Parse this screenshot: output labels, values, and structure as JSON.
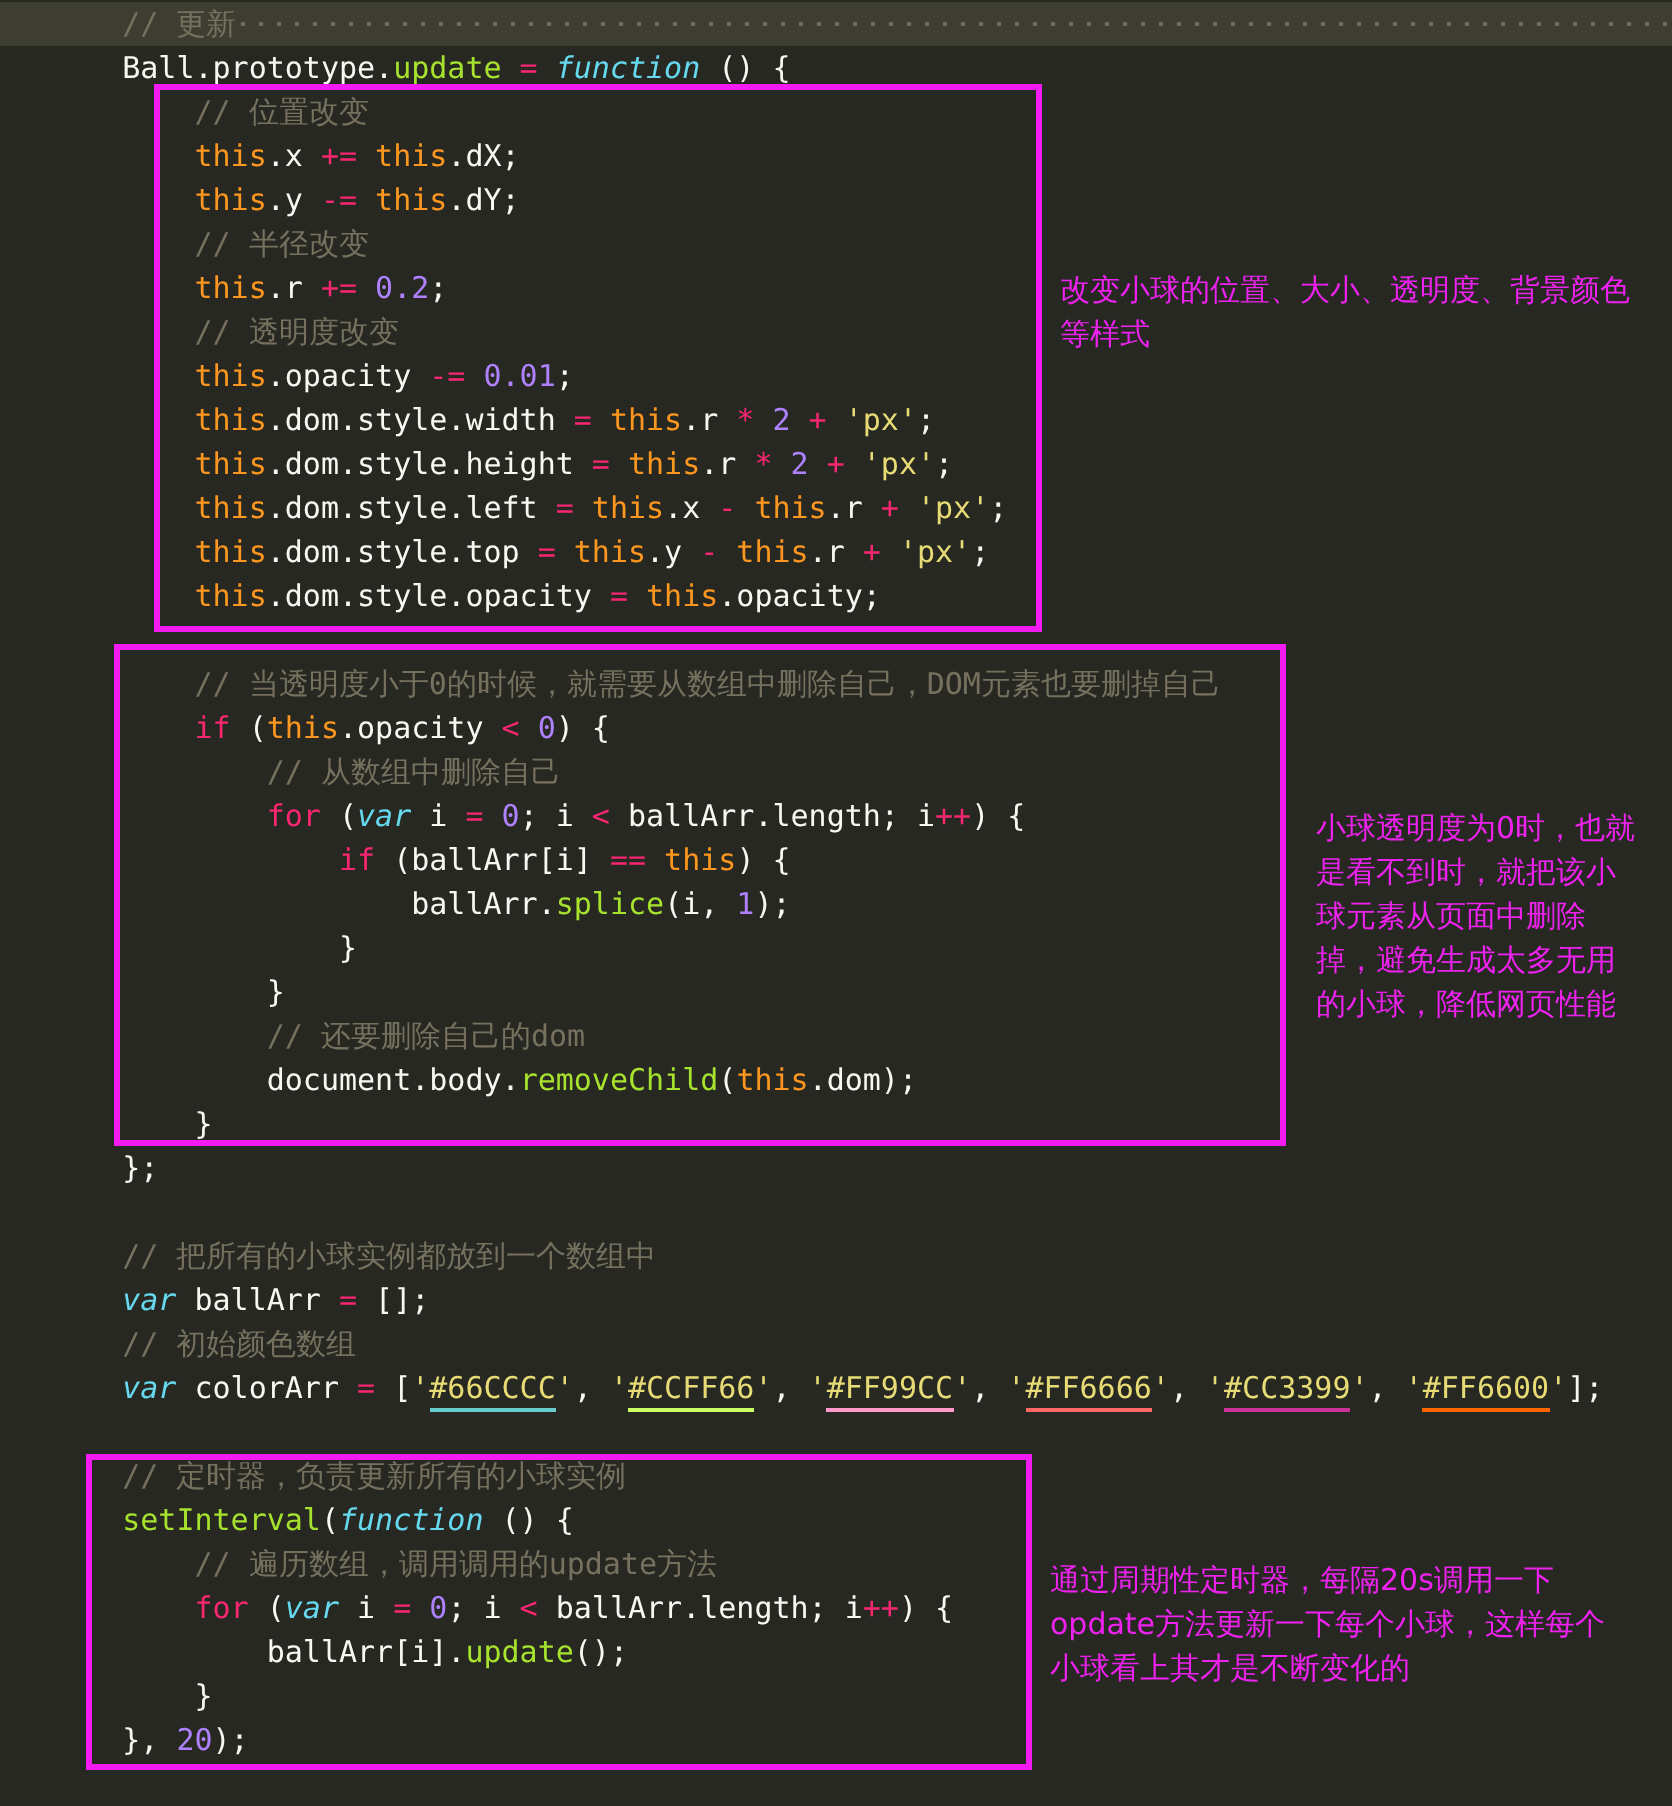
{
  "lines": [
    {
      "kind": "code",
      "current": true,
      "tokens": [
        {
          "kind": "comment",
          "text": "    // 更新"
        }
      ]
    },
    {
      "kind": "code",
      "current": false,
      "tokens": [
        {
          "kind": "plain",
          "text": "    Ball.prototype."
        },
        {
          "kind": "func",
          "text": "update"
        },
        {
          "kind": "op",
          "text": " ="
        },
        {
          "kind": "storage",
          "text": " function"
        },
        {
          "kind": "plain",
          "text": " () {"
        }
      ]
    },
    {
      "kind": "code",
      "current": false,
      "tokens": [
        {
          "kind": "comment",
          "text": "        // 位置改变"
        }
      ]
    },
    {
      "kind": "code",
      "current": false,
      "tokens": [
        {
          "kind": "self",
          "text": "        this"
        },
        {
          "kind": "plain",
          "text": ".x"
        },
        {
          "kind": "op",
          "text": " +="
        },
        {
          "kind": "self",
          "text": " this"
        },
        {
          "kind": "plain",
          "text": ".dX;"
        }
      ]
    },
    {
      "kind": "code",
      "current": false,
      "tokens": [
        {
          "kind": "self",
          "text": "        this"
        },
        {
          "kind": "plain",
          "text": ".y"
        },
        {
          "kind": "op",
          "text": " -="
        },
        {
          "kind": "self",
          "text": " this"
        },
        {
          "kind": "plain",
          "text": ".dY;"
        }
      ]
    },
    {
      "kind": "code",
      "current": false,
      "tokens": [
        {
          "kind": "comment",
          "text": "        // 半径改变"
        }
      ]
    },
    {
      "kind": "code",
      "current": false,
      "tokens": [
        {
          "kind": "self",
          "text": "        this"
        },
        {
          "kind": "plain",
          "text": ".r"
        },
        {
          "kind": "op",
          "text": " +="
        },
        {
          "kind": "number",
          "text": " 0.2"
        },
        {
          "kind": "plain",
          "text": ";"
        }
      ]
    },
    {
      "kind": "code",
      "current": false,
      "tokens": [
        {
          "kind": "comment",
          "text": "        // 透明度改变"
        }
      ]
    },
    {
      "kind": "code",
      "current": false,
      "tokens": [
        {
          "kind": "self",
          "text": "        this"
        },
        {
          "kind": "plain",
          "text": ".opacity"
        },
        {
          "kind": "op",
          "text": " -="
        },
        {
          "kind": "number",
          "text": " 0.01"
        },
        {
          "kind": "plain",
          "text": ";"
        }
      ]
    },
    {
      "kind": "code",
      "current": false,
      "tokens": [
        {
          "kind": "self",
          "text": "        this"
        },
        {
          "kind": "plain",
          "text": ".dom.style.width"
        },
        {
          "kind": "op",
          "text": " ="
        },
        {
          "kind": "self",
          "text": " this"
        },
        {
          "kind": "plain",
          "text": ".r"
        },
        {
          "kind": "op",
          "text": " *"
        },
        {
          "kind": "number",
          "text": " 2"
        },
        {
          "kind": "op",
          "text": " +"
        },
        {
          "kind": "string",
          "text": " 'px'"
        },
        {
          "kind": "plain",
          "text": ";"
        }
      ]
    },
    {
      "kind": "code",
      "current": false,
      "tokens": [
        {
          "kind": "self",
          "text": "        this"
        },
        {
          "kind": "plain",
          "text": ".dom.style.height"
        },
        {
          "kind": "op",
          "text": " ="
        },
        {
          "kind": "self",
          "text": " this"
        },
        {
          "kind": "plain",
          "text": ".r"
        },
        {
          "kind": "op",
          "text": " *"
        },
        {
          "kind": "number",
          "text": " 2"
        },
        {
          "kind": "op",
          "text": " +"
        },
        {
          "kind": "string",
          "text": " 'px'"
        },
        {
          "kind": "plain",
          "text": ";"
        }
      ]
    },
    {
      "kind": "code",
      "current": false,
      "tokens": [
        {
          "kind": "self",
          "text": "        this"
        },
        {
          "kind": "plain",
          "text": ".dom.style.left"
        },
        {
          "kind": "op",
          "text": " ="
        },
        {
          "kind": "self",
          "text": " this"
        },
        {
          "kind": "plain",
          "text": ".x"
        },
        {
          "kind": "op",
          "text": " -"
        },
        {
          "kind": "self",
          "text": " this"
        },
        {
          "kind": "plain",
          "text": ".r"
        },
        {
          "kind": "op",
          "text": " +"
        },
        {
          "kind": "string",
          "text": " 'px'"
        },
        {
          "kind": "plain",
          "text": ";"
        }
      ]
    },
    {
      "kind": "code",
      "current": false,
      "tokens": [
        {
          "kind": "self",
          "text": "        this"
        },
        {
          "kind": "plain",
          "text": ".dom.style.top"
        },
        {
          "kind": "op",
          "text": " ="
        },
        {
          "kind": "self",
          "text": " this"
        },
        {
          "kind": "plain",
          "text": ".y"
        },
        {
          "kind": "op",
          "text": " -"
        },
        {
          "kind": "self",
          "text": " this"
        },
        {
          "kind": "plain",
          "text": ".r"
        },
        {
          "kind": "op",
          "text": " +"
        },
        {
          "kind": "string",
          "text": " 'px'"
        },
        {
          "kind": "plain",
          "text": ";"
        }
      ]
    },
    {
      "kind": "code",
      "current": false,
      "tokens": [
        {
          "kind": "self",
          "text": "        this"
        },
        {
          "kind": "plain",
          "text": ".dom.style.opacity"
        },
        {
          "kind": "op",
          "text": " ="
        },
        {
          "kind": "self",
          "text": " this"
        },
        {
          "kind": "plain",
          "text": ".opacity;"
        }
      ]
    },
    {
      "kind": "blank",
      "current": false
    },
    {
      "kind": "code",
      "current": false,
      "tokens": [
        {
          "kind": "comment",
          "text": "        // 当透明度小于0的时候，就需要从数组中删除自己，DOM元素也要删掉自己"
        }
      ]
    },
    {
      "kind": "code",
      "current": false,
      "tokens": [
        {
          "kind": "op",
          "text": "        if"
        },
        {
          "kind": "plain",
          "text": " ("
        },
        {
          "kind": "self",
          "text": "this"
        },
        {
          "kind": "plain",
          "text": ".opacity"
        },
        {
          "kind": "op",
          "text": " <"
        },
        {
          "kind": "number",
          "text": " 0"
        },
        {
          "kind": "plain",
          "text": ") {"
        }
      ]
    },
    {
      "kind": "code",
      "current": false,
      "tokens": [
        {
          "kind": "comment",
          "text": "            // 从数组中删除自己"
        }
      ]
    },
    {
      "kind": "code",
      "current": false,
      "tokens": [
        {
          "kind": "op",
          "text": "            for"
        },
        {
          "kind": "plain",
          "text": " ("
        },
        {
          "kind": "storage",
          "text": "var"
        },
        {
          "kind": "plain",
          "text": " i"
        },
        {
          "kind": "op",
          "text": " ="
        },
        {
          "kind": "number",
          "text": " 0"
        },
        {
          "kind": "plain",
          "text": "; i"
        },
        {
          "kind": "op",
          "text": " <"
        },
        {
          "kind": "plain",
          "text": " ballArr.length; i"
        },
        {
          "kind": "op",
          "text": "++"
        },
        {
          "kind": "plain",
          "text": ") {"
        }
      ]
    },
    {
      "kind": "code",
      "current": false,
      "tokens": [
        {
          "kind": "op",
          "text": "                if"
        },
        {
          "kind": "plain",
          "text": " (ballArr[i]"
        },
        {
          "kind": "op",
          "text": " =="
        },
        {
          "kind": "self",
          "text": " this"
        },
        {
          "kind": "plain",
          "text": ") {"
        }
      ]
    },
    {
      "kind": "code",
      "current": false,
      "tokens": [
        {
          "kind": "plain",
          "text": "                    ballArr."
        },
        {
          "kind": "func",
          "text": "splice"
        },
        {
          "kind": "plain",
          "text": "(i,"
        },
        {
          "kind": "number",
          "text": " 1"
        },
        {
          "kind": "plain",
          "text": ");"
        }
      ]
    },
    {
      "kind": "code",
      "current": false,
      "tokens": [
        {
          "kind": "plain",
          "text": "                }"
        }
      ]
    },
    {
      "kind": "code",
      "current": false,
      "tokens": [
        {
          "kind": "plain",
          "text": "            }"
        }
      ]
    },
    {
      "kind": "code",
      "current": false,
      "tokens": [
        {
          "kind": "comment",
          "text": "            // 还要删除自己的dom"
        }
      ]
    },
    {
      "kind": "code",
      "current": false,
      "tokens": [
        {
          "kind": "plain",
          "text": "            document.body."
        },
        {
          "kind": "func",
          "text": "removeChild"
        },
        {
          "kind": "plain",
          "text": "("
        },
        {
          "kind": "self",
          "text": "this"
        },
        {
          "kind": "plain",
          "text": ".dom);"
        }
      ]
    },
    {
      "kind": "code",
      "current": false,
      "tokens": [
        {
          "kind": "plain",
          "text": "        }"
        }
      ]
    },
    {
      "kind": "code",
      "current": false,
      "tokens": [
        {
          "kind": "plain",
          "text": "    };"
        }
      ]
    },
    {
      "kind": "blank",
      "current": false
    },
    {
      "kind": "code",
      "current": false,
      "tokens": [
        {
          "kind": "comment",
          "text": "    // 把所有的小球实例都放到一个数组中"
        }
      ]
    },
    {
      "kind": "code",
      "current": false,
      "tokens": [
        {
          "kind": "storage",
          "text": "    var"
        },
        {
          "kind": "plain",
          "text": " ballArr"
        },
        {
          "kind": "op",
          "text": " ="
        },
        {
          "kind": "plain",
          "text": " [];"
        }
      ]
    },
    {
      "kind": "code",
      "current": false,
      "tokens": [
        {
          "kind": "comment",
          "text": "    // 初始颜色数组"
        }
      ]
    },
    {
      "kind": "code",
      "current": false,
      "tokens": [
        {
          "kind": "storage",
          "text": "    var"
        },
        {
          "kind": "plain",
          "text": " colorArr"
        },
        {
          "kind": "op",
          "text": " ="
        },
        {
          "kind": "plain",
          "text": " ["
        },
        {
          "kind": "string",
          "text": "'"
        },
        {
          "kind": "swatch",
          "text": "#66CCCC",
          "color": "#66cccc"
        },
        {
          "kind": "string",
          "text": "'"
        },
        {
          "kind": "plain",
          "text": ","
        },
        {
          "kind": "string",
          "text": " '"
        },
        {
          "kind": "swatch",
          "text": "#CCFF66",
          "color": "#ccff66"
        },
        {
          "kind": "string",
          "text": "'"
        },
        {
          "kind": "plain",
          "text": ","
        },
        {
          "kind": "string",
          "text": " '"
        },
        {
          "kind": "swatch",
          "text": "#FF99CC",
          "color": "#ff99cc"
        },
        {
          "kind": "string",
          "text": "'"
        },
        {
          "kind": "plain",
          "text": ","
        },
        {
          "kind": "string",
          "text": " '"
        },
        {
          "kind": "swatch",
          "text": "#FF6666",
          "color": "#ff6666"
        },
        {
          "kind": "string",
          "text": "'"
        },
        {
          "kind": "plain",
          "text": ","
        },
        {
          "kind": "string",
          "text": " '"
        },
        {
          "kind": "swatch",
          "text": "#CC3399",
          "color": "#cc3399"
        },
        {
          "kind": "string",
          "text": "'"
        },
        {
          "kind": "plain",
          "text": ","
        },
        {
          "kind": "string",
          "text": " '"
        },
        {
          "kind": "swatch",
          "text": "#FF6600",
          "color": "#ff6600"
        },
        {
          "kind": "string",
          "text": "'"
        },
        {
          "kind": "plain",
          "text": "];"
        }
      ]
    },
    {
      "kind": "blank",
      "current": false
    },
    {
      "kind": "code",
      "current": false,
      "tokens": [
        {
          "kind": "comment",
          "text": "    // 定时器，负责更新所有的小球实例"
        }
      ]
    },
    {
      "kind": "code",
      "current": false,
      "tokens": [
        {
          "kind": "func",
          "text": "    setInterval"
        },
        {
          "kind": "plain",
          "text": "("
        },
        {
          "kind": "storage",
          "text": "function"
        },
        {
          "kind": "plain",
          "text": " () {"
        }
      ]
    },
    {
      "kind": "code",
      "current": false,
      "tokens": [
        {
          "kind": "comment",
          "text": "        // 遍历数组，调用调用的update方法"
        }
      ]
    },
    {
      "kind": "code",
      "current": false,
      "tokens": [
        {
          "kind": "op",
          "text": "        for"
        },
        {
          "kind": "plain",
          "text": " ("
        },
        {
          "kind": "storage",
          "text": "var"
        },
        {
          "kind": "plain",
          "text": " i"
        },
        {
          "kind": "op",
          "text": " ="
        },
        {
          "kind": "number",
          "text": " 0"
        },
        {
          "kind": "plain",
          "text": "; i"
        },
        {
          "kind": "op",
          "text": " <"
        },
        {
          "kind": "plain",
          "text": " ballArr.length; i"
        },
        {
          "kind": "op",
          "text": "++"
        },
        {
          "kind": "plain",
          "text": ") {"
        }
      ]
    },
    {
      "kind": "code",
      "current": false,
      "tokens": [
        {
          "kind": "plain",
          "text": "            ballArr[i]."
        },
        {
          "kind": "func",
          "text": "update"
        },
        {
          "kind": "plain",
          "text": "();"
        }
      ]
    },
    {
      "kind": "code",
      "current": false,
      "tokens": [
        {
          "kind": "plain",
          "text": "        }"
        }
      ]
    },
    {
      "kind": "code",
      "current": false,
      "tokens": [
        {
          "kind": "plain",
          "text": "    },"
        },
        {
          "kind": "number",
          "text": " 20"
        },
        {
          "kind": "plain",
          "text": ");"
        }
      ]
    }
  ],
  "annotations": [
    {
      "note": "改变小球的位置、大小、透明度、背景颜色等样式"
    },
    {
      "note": "小球透明度为0时，也就是看不到时，就把该小球元素从页面中删除掉，避免生成太多无用的小球，降低网页性能"
    },
    {
      "note": "通过周期性定时器，每隔20s调用一下opdate方法更新一下每个小球，这样每个小球看上其才是不断变化的"
    }
  ]
}
